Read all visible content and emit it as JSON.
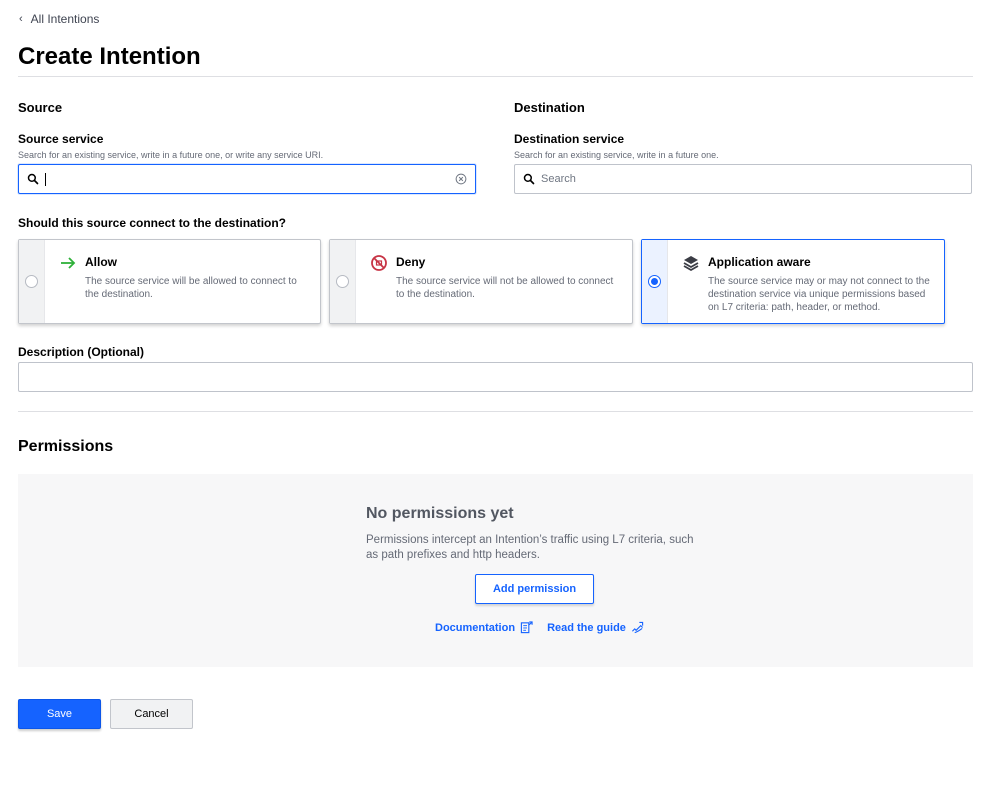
{
  "breadcrumb": {
    "back_label": "All Intentions"
  },
  "page": {
    "title": "Create Intention"
  },
  "source": {
    "section_title": "Source",
    "label": "Source service",
    "help": "Search for an existing service, write in a future one, or write any service URI.",
    "value": ""
  },
  "destination": {
    "section_title": "Destination",
    "label": "Destination service",
    "help": "Search for an existing service, write in a future one.",
    "placeholder": "Search"
  },
  "connect": {
    "question": "Should this source connect to the destination?",
    "options": [
      {
        "title": "Allow",
        "description": "The source service will be allowed to connect to the destination.",
        "icon": "arrow-right-icon",
        "selected": false
      },
      {
        "title": "Deny",
        "description": "The source service will not be allowed to connect to the destination.",
        "icon": "deny-icon",
        "selected": false
      },
      {
        "title": "Application aware",
        "description": "The source service may or may not connect to the destination service via unique permissions based on L7 criteria: path, header, or method.",
        "icon": "layers-icon",
        "selected": true
      }
    ]
  },
  "description": {
    "label": "Description (Optional)",
    "value": ""
  },
  "permissions": {
    "title": "Permissions",
    "empty_title": "No permissions yet",
    "empty_body": "Permissions intercept an Intention’s traffic using L7 criteria, such as path prefixes and http headers.",
    "add_label": "Add permission",
    "doc_link": "Documentation",
    "guide_link": "Read the guide"
  },
  "actions": {
    "save": "Save",
    "cancel": "Cancel"
  },
  "colors": {
    "accent": "#1563ff",
    "allow": "#2eb039",
    "deny": "#c73445"
  }
}
